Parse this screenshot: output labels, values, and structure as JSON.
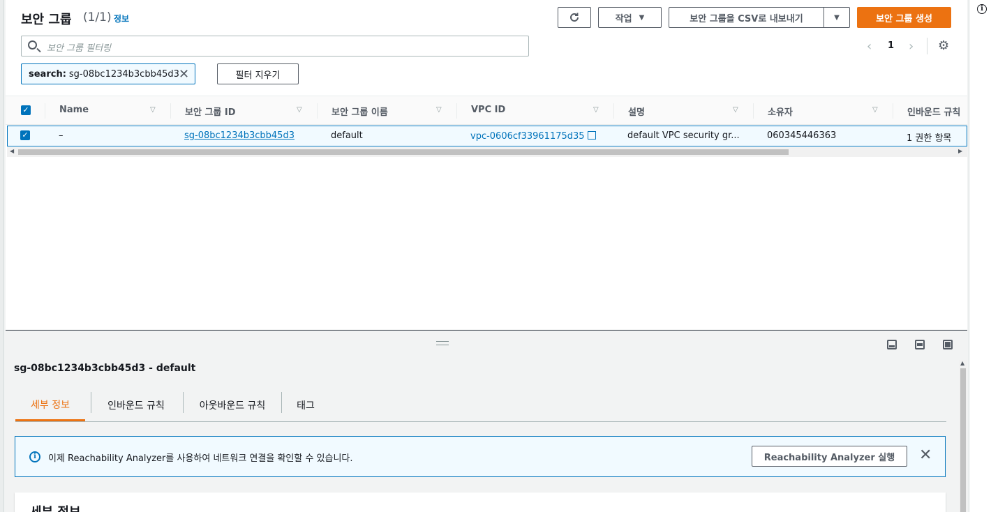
{
  "header": {
    "title": "보안 그룹",
    "count": "(1/1)",
    "info_link": "정보"
  },
  "toolbar": {
    "refresh_icon": "refresh-icon",
    "actions_label": "작업",
    "export_label": "보안 그룹을 CSV로 내보내기",
    "create_label": "보안 그룹 생성"
  },
  "search": {
    "placeholder": "보안 그룹 필터링"
  },
  "pagination": {
    "current_page": "1"
  },
  "filter_token": {
    "key": "search:",
    "value": "sg-08bc1234b3cbb45d3",
    "clear_label": "필터 지우기"
  },
  "table": {
    "columns": [
      "Name",
      "보안 그룹 ID",
      "보안 그룹 이름",
      "VPC ID",
      "설명",
      "소유자",
      "인바운드 규칙"
    ],
    "rows": [
      {
        "name": "–",
        "security_group_id": "sg-08bc1234b3cbb45d3",
        "security_group_name": "default",
        "vpc_id": "vpc-0606cf33961175d35",
        "description": "default VPC security gr...",
        "owner": "060345446363",
        "inbound_rules": "1 권한 항목"
      }
    ]
  },
  "detail": {
    "title": "sg-08bc1234b3cbb45d3 - default",
    "tabs": [
      "세부 정보",
      "인바운드 규칙",
      "아웃바운드 규칙",
      "태그"
    ],
    "active_tab": "세부 정보",
    "alert_message": "이제 Reachability Analyzer를 사용하여 네트워크 연결을 확인할 수 있습니다.",
    "alert_button": "Reachability Analyzer 실행",
    "section_heading": "세부 정보"
  },
  "colors": {
    "accent_orange": "#ec7211",
    "link_blue": "#0073bb"
  }
}
